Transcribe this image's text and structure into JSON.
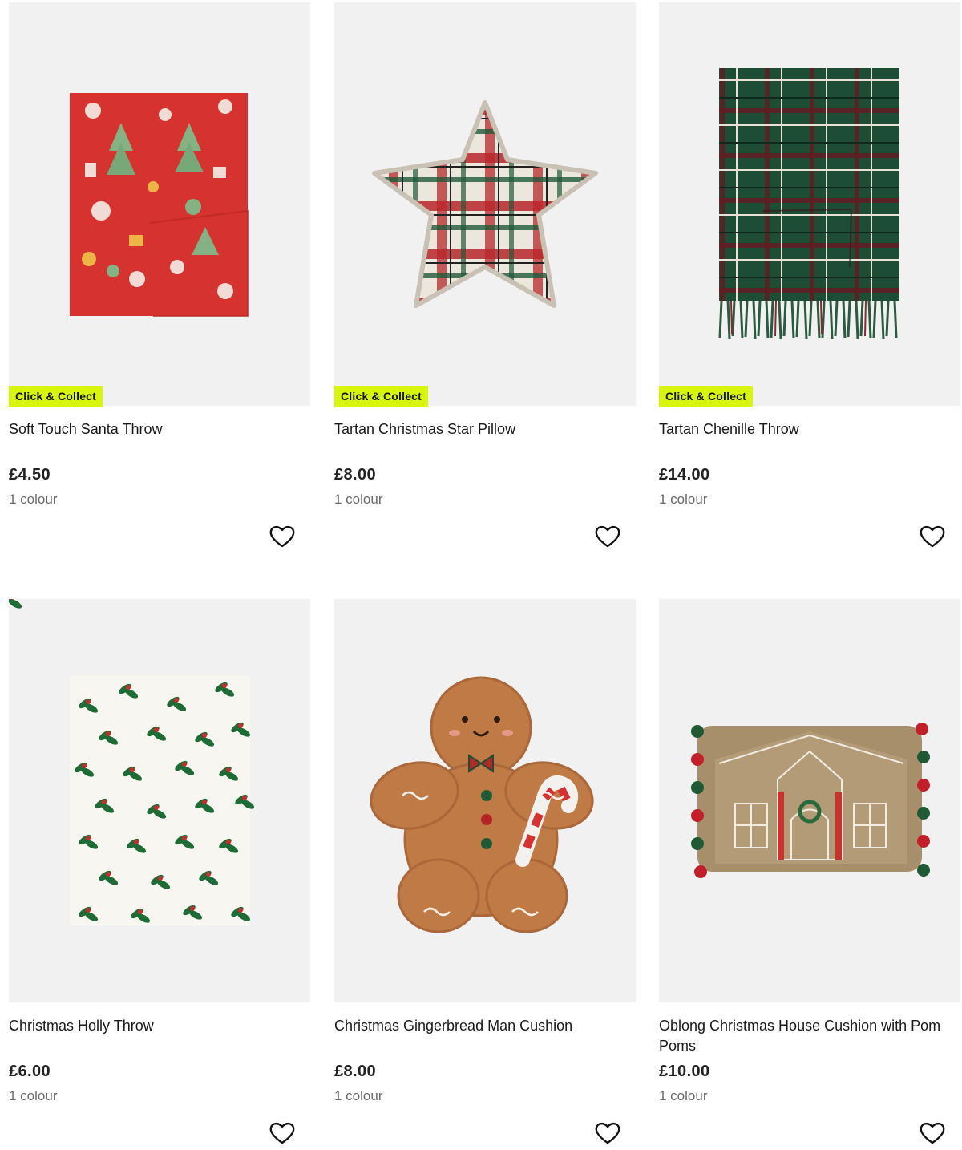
{
  "products": [
    {
      "badge": "Click & Collect",
      "name": "Soft Touch Santa Throw",
      "price": "£4.50",
      "colours": "1 colour",
      "wishlist_icon": "heart-outline-icon"
    },
    {
      "badge": "Click & Collect",
      "name": "Tartan Christmas Star Pillow",
      "price": "£8.00",
      "colours": "1 colour",
      "wishlist_icon": "heart-outline-icon"
    },
    {
      "badge": "Click & Collect",
      "name": "Tartan Chenille Throw",
      "price": "£14.00",
      "colours": "1 colour",
      "wishlist_icon": "heart-outline-icon"
    },
    {
      "name": "Christmas Holly Throw",
      "price": "£6.00",
      "colours": "1 colour",
      "wishlist_icon": "heart-outline-icon"
    },
    {
      "name": "Christmas Gingerbread Man Cushion",
      "price": "£8.00",
      "colours": "1 colour",
      "wishlist_icon": "heart-outline-icon"
    },
    {
      "name": "Oblong Christmas House Cushion with Pom Poms",
      "price": "£10.00",
      "colours": "1 colour",
      "wishlist_icon": "heart-outline-icon"
    }
  ],
  "colors": {
    "badge_bg": "#d7f60a",
    "image_bg": "#f1f1f1",
    "muted_text": "#6b6b6b"
  }
}
